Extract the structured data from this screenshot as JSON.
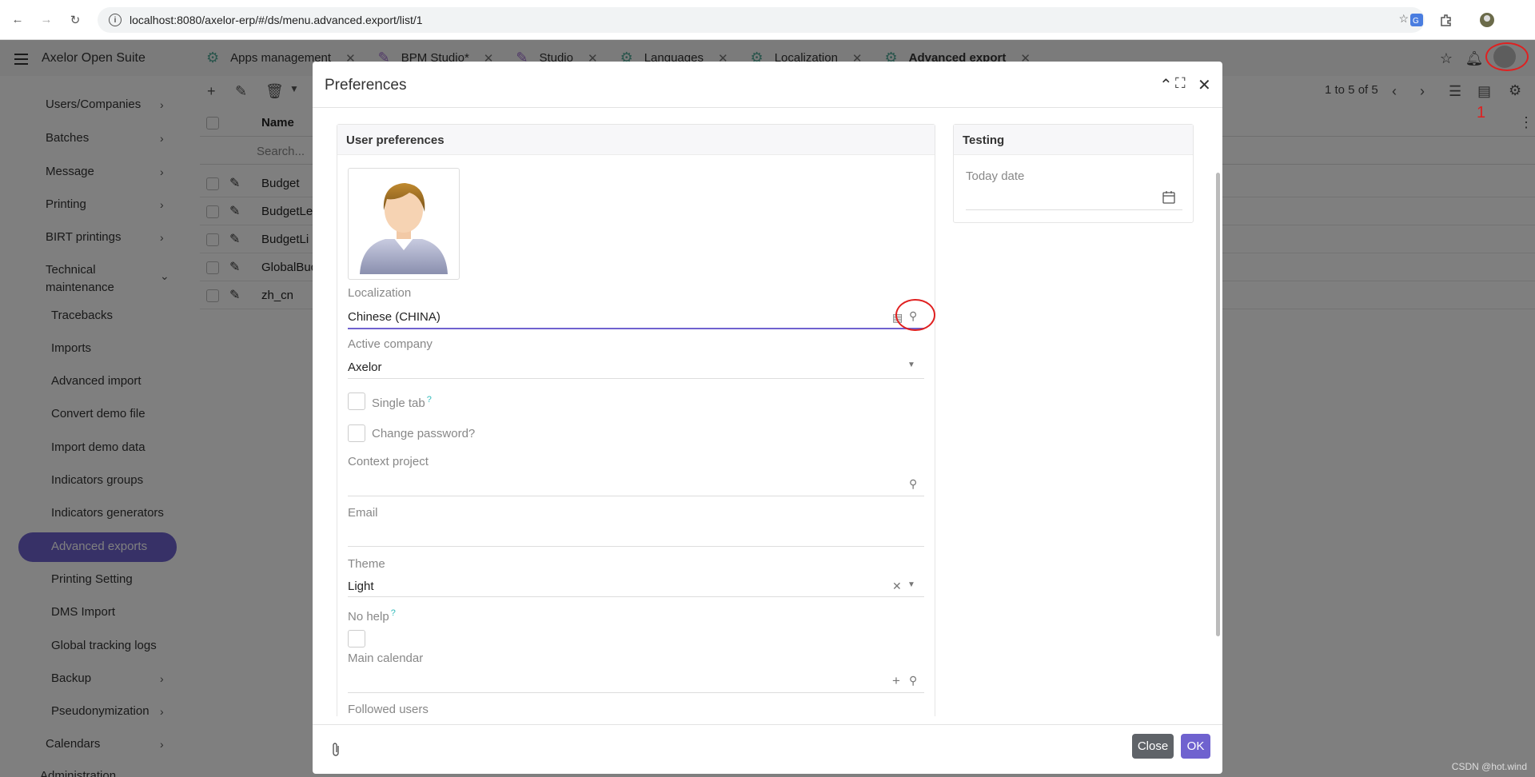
{
  "browser": {
    "url": "localhost:8080/axelor-erp/#/ds/menu.advanced.export/list/1"
  },
  "app": {
    "brand": "Axelor Open Suite",
    "tabs": [
      {
        "label": "Apps management"
      },
      {
        "label": "BPM Studio*"
      },
      {
        "label": "Studio"
      },
      {
        "label": "Languages"
      },
      {
        "label": "Localization"
      },
      {
        "label": "Advanced export"
      }
    ],
    "annotation_number": "1"
  },
  "sidebar": {
    "items": [
      {
        "label": "Users/Companies"
      },
      {
        "label": "Batches"
      },
      {
        "label": "Message"
      },
      {
        "label": "Printing"
      },
      {
        "label": "BIRT printings"
      },
      {
        "label": "Technical maintenance"
      }
    ],
    "sub": [
      {
        "label": "Tracebacks"
      },
      {
        "label": "Imports"
      },
      {
        "label": "Advanced import"
      },
      {
        "label": "Convert demo file"
      },
      {
        "label": "Import demo data"
      },
      {
        "label": "Indicators groups"
      },
      {
        "label": "Indicators generators"
      },
      {
        "label": "Advanced exports"
      },
      {
        "label": "Printing Setting"
      },
      {
        "label": "DMS Import"
      },
      {
        "label": "Global tracking logs"
      },
      {
        "label": "Backup"
      },
      {
        "label": "Pseudonymization"
      },
      {
        "label": "Calendars"
      },
      {
        "label": "Administration"
      }
    ]
  },
  "list": {
    "pager": "1 to 5 of 5",
    "column": "Name",
    "search_placeholder": "Search...",
    "rows": [
      "Budget",
      "BudgetLe",
      "BudgetLi",
      "GlobalBud",
      "zh_cn"
    ]
  },
  "dialog": {
    "title": "Preferences",
    "user_prefs": {
      "title": "User preferences",
      "localization_label": "Localization",
      "localization_value": "Chinese (CHINA)",
      "active_company_label": "Active company",
      "active_company_value": "Axelor",
      "single_tab_label": "Single tab",
      "change_password_label": "Change password?",
      "context_project_label": "Context project",
      "email_label": "Email",
      "theme_label": "Theme",
      "theme_value": "Light",
      "no_help_label": "No help",
      "main_calendar_label": "Main calendar",
      "followed_users_label": "Followed users",
      "help_mark": "?"
    },
    "testing": {
      "title": "Testing",
      "today_label": "Today date"
    },
    "close_label": "Close",
    "ok_label": "OK"
  },
  "watermark": "CSDN @hot.wind",
  "colors": {
    "accent": "#6f62cf",
    "annotation": "#e02020"
  }
}
